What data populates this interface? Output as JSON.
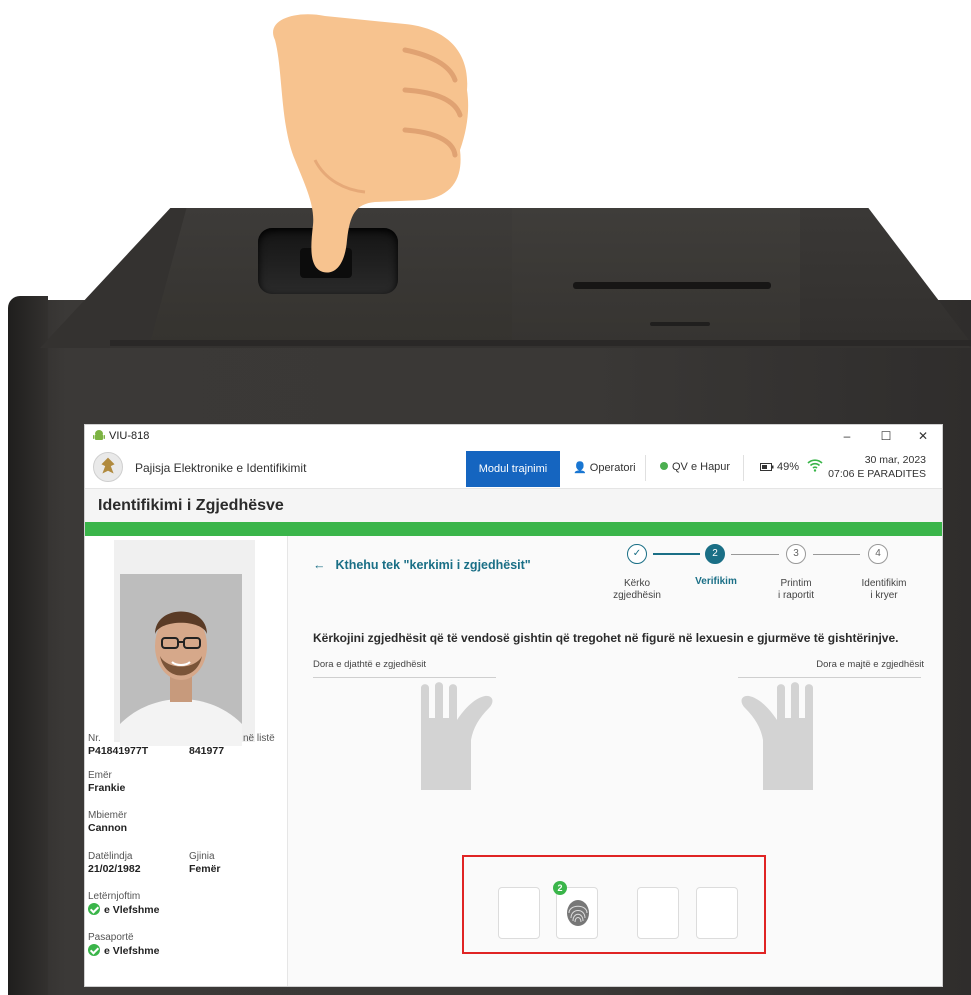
{
  "window": {
    "title": "VIU-818",
    "minimize": "–",
    "maximize": "☐",
    "close": "✕"
  },
  "appbar": {
    "app_name": "Pajisja Elektronike e Identifikimit",
    "training_button": "Modul trajnimi",
    "operator": "Operatori",
    "station_status": "QV e Hapur",
    "battery": "49%",
    "date": "30 mar, 2023",
    "time": "07:06 E PARADITES"
  },
  "page": {
    "title": "Identifikimi i Zgjedhësve"
  },
  "voter": {
    "id_label_left": "Nr.",
    "id_label_right": "në listë",
    "id_number": "P41841977T",
    "list_number": "841977",
    "first_name_label": "Emër",
    "first_name": "Frankie",
    "last_name_label": "Mbiemër",
    "last_name": "Cannon",
    "dob_label": "Datëlindja",
    "dob": "21/02/1982",
    "gender_label": "Gjinia",
    "gender": "Femër",
    "id_card_label": "Letërnjoftim",
    "id_card_status": "e Vlefshme",
    "passport_label": "Pasaportë",
    "passport_status": "e Vlefshme"
  },
  "main": {
    "back_link": "Kthehu tek \"kerkimi i zgjedhësit\"",
    "instruction": "Kërkojini zgjedhësit që të vendosë gishtin që tregohet në figurë në lexuesin e gjurmëve të gishtërinjve.",
    "right_hand_label": "Dora e djathtë e zgjedhësit",
    "left_hand_label": "Dora e majtë e zgjedhësit",
    "finger_badge": "2"
  },
  "stepper": {
    "steps": [
      {
        "number": "✓",
        "label_line1": "Kërko",
        "label_line2": "zgjedhësin",
        "state": "done"
      },
      {
        "number": "2",
        "label_line1": "Verifikim",
        "label_line2": "",
        "state": "active"
      },
      {
        "number": "3",
        "label_line1": "Printim",
        "label_line2": "i raportit",
        "state": "todo"
      },
      {
        "number": "4",
        "label_line1": "Identifikim",
        "label_line2": "i kryer",
        "state": "todo"
      }
    ]
  },
  "colors": {
    "brand_blue": "#1565c0",
    "teal": "#1a6f86",
    "green": "#3ab54a",
    "highlight_red": "#e02424"
  }
}
